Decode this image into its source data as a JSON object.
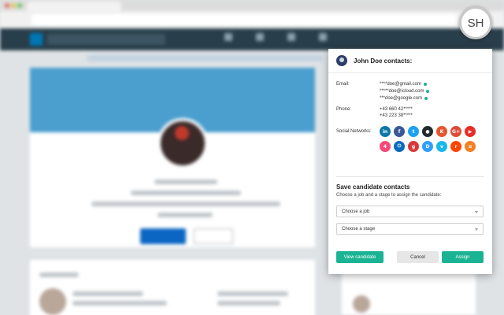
{
  "badge": {
    "initials": "SH"
  },
  "panel": {
    "title": "John Doe contacts:",
    "email_label": "Email:",
    "emails": [
      "****doe@gmail.com",
      "*****doe@icloud.com",
      "***doe@google.com"
    ],
    "phone_label": "Phone:",
    "phones": [
      "+43 660 42*****",
      "+43 223 38*****"
    ],
    "social_label": "Social Networks:",
    "social_networks": [
      {
        "name": "linkedin-icon",
        "glyph": "in",
        "color": "#0e76a8"
      },
      {
        "name": "facebook-icon",
        "glyph": "f",
        "color": "#3b5998"
      },
      {
        "name": "twitter-icon",
        "glyph": "t",
        "color": "#1da1f2"
      },
      {
        "name": "github-icon",
        "glyph": "●",
        "color": "#24292e"
      },
      {
        "name": "klout-icon",
        "glyph": "K",
        "color": "#e4572e"
      },
      {
        "name": "googleplus-icon",
        "glyph": "G+",
        "color": "#dd4b39"
      },
      {
        "name": "youtube-icon",
        "glyph": "▶",
        "color": "#e52d27"
      },
      {
        "name": "foursquare-icon",
        "glyph": "4",
        "color": "#f94877"
      },
      {
        "name": "power-icon",
        "glyph": "⏻",
        "color": "#0b6cbf"
      },
      {
        "name": "gravatar-icon",
        "glyph": "g",
        "color": "#d63a3a"
      },
      {
        "name": "disqus-icon",
        "glyph": "D",
        "color": "#2e9fff"
      },
      {
        "name": "vimeo-icon",
        "glyph": "v",
        "color": "#1ab7ea"
      },
      {
        "name": "reddit-icon",
        "glyph": "r",
        "color": "#ff4500"
      },
      {
        "name": "stackoverflow-icon",
        "glyph": "≡",
        "color": "#f48024"
      }
    ],
    "save_title": "Save candidate contacts",
    "save_subtitle": "Choose a job and a stage to assign the candidate:",
    "job_select": "Choose a job",
    "stage_select": "Choose a stage",
    "view_button": "View candidate",
    "cancel_button": "Cancel",
    "assign_button": "Assign"
  },
  "colors": {
    "accent": "#1ab394",
    "verified_dot": "#1ab394"
  }
}
